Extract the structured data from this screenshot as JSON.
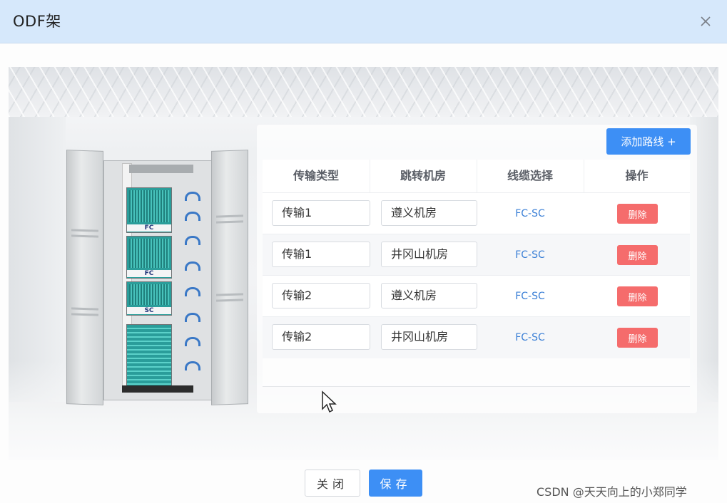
{
  "dialog": {
    "title": "ODF架"
  },
  "toolbar": {
    "add_route_label": "添加路线 +"
  },
  "table": {
    "headers": [
      "传输类型",
      "跳转机房",
      "线缆选择",
      "操作"
    ],
    "rows": [
      {
        "transport": "传输1",
        "room": "遵义机房",
        "cable": "FC-SC",
        "action": "删除"
      },
      {
        "transport": "传输1",
        "room": "井冈山机房",
        "cable": "FC-SC",
        "action": "删除"
      },
      {
        "transport": "传输2",
        "room": "遵义机房",
        "cable": "FC-SC",
        "action": "删除"
      },
      {
        "transport": "传输2",
        "room": "井冈山机房",
        "cable": "FC-SC",
        "action": "删除"
      }
    ]
  },
  "cabinet": {
    "panel_labels": [
      "FC",
      "FC",
      "SC"
    ]
  },
  "footer": {
    "close_label": "关闭",
    "save_label": "保存"
  },
  "watermark": "CSDN @天天向上的小郑同学",
  "colors": {
    "header_bg": "#d6e8fb",
    "primary": "#3d8ff5",
    "danger": "#f56c6c",
    "link": "#3a7fd6"
  },
  "icons": {
    "close": "close-icon",
    "cursor": "mouse-pointer-icon"
  }
}
